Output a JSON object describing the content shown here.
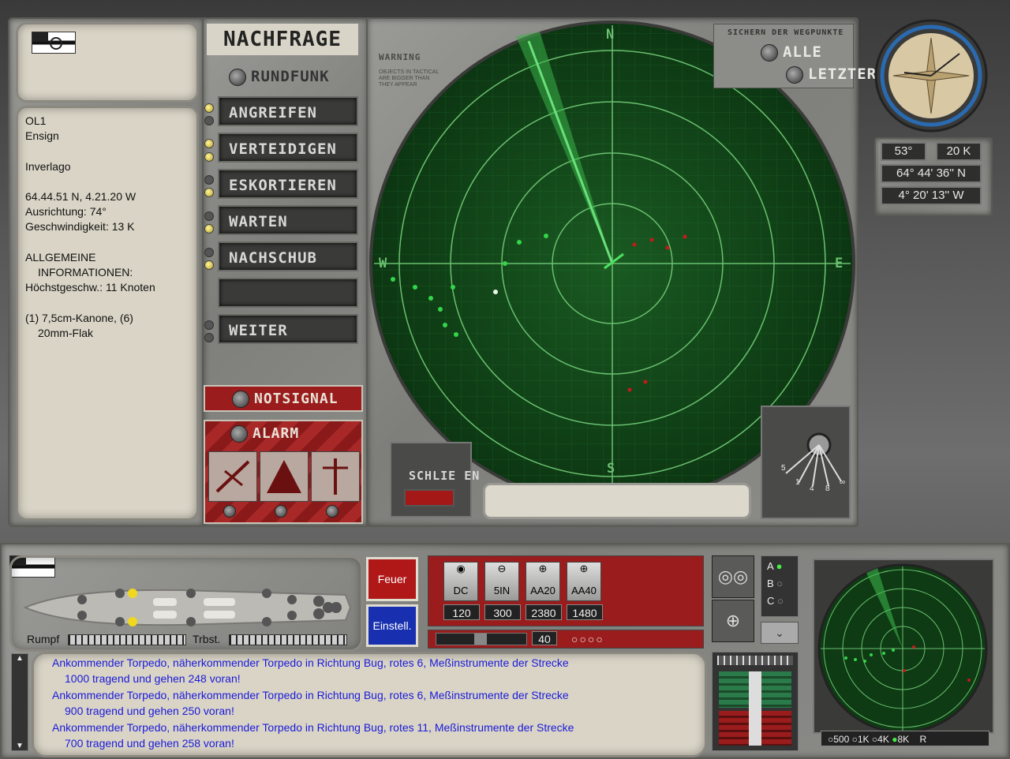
{
  "colors": {
    "radar_green": "#1f7a2a",
    "contact_green": "#33d64a",
    "contact_red": "#c41a1a",
    "alarm_red": "#9a1c1c",
    "message_blue": "#1a1ad8"
  },
  "info": {
    "id": "OL1",
    "rank": "Ensign",
    "name": "Inverlago",
    "position": "64.44.51 N, 4.21.20 W",
    "heading": "Ausrichtung: 74°",
    "speed": "Geschwindigkeit: 13 K",
    "general_1": "ALLGEMEINE",
    "general_2": "INFORMATIONEN:",
    "max_speed": "Höchstgeschw.: 11 Knoten",
    "arm_1": "(1) 7,5cm-Kanone, (6)",
    "arm_2": "20mm-Flak"
  },
  "menu": {
    "title": "NACHFRAGE",
    "radio": "RUNDFUNK",
    "items": [
      "ANGREIFEN",
      "VERTEIDIGEN",
      "ESKORTIEREN",
      "WARTEN",
      "NACHSCHUB",
      "",
      "WEITER"
    ],
    "distress": "NOTSIGNAL",
    "alarm": "ALARM"
  },
  "radar": {
    "warning": "WARNING",
    "warning_sub": [
      "OBJECTS IN TACTICAL",
      "ARE BIGGER THAN",
      "THEY APPEAR"
    ],
    "north": "N",
    "south": "S",
    "east": "E",
    "west": "W",
    "waypoints_title": "SICHERN DER WEGPUNKTE",
    "all": "ALLE",
    "last": "LETZTER",
    "close": "SCHLIE EN",
    "scale_labels": [
      "5",
      "1",
      "4",
      "8",
      "∞"
    ]
  },
  "compass": {
    "bearing": "53°",
    "range": "20 K",
    "lat": "64° 44' 36'' N",
    "lon": "4° 20' 13'' W"
  },
  "bottom": {
    "hull_label": "Rumpf",
    "drive_label": "Trbst.",
    "fire": "Feuer",
    "settings": "Einstell.",
    "weapons": [
      {
        "name": "DC",
        "ammo": "120"
      },
      {
        "name": "5IN",
        "ammo": "300"
      },
      {
        "name": "AA20",
        "ammo": "2380"
      },
      {
        "name": "AA40",
        "ammo": "1480"
      }
    ],
    "elevation": "40",
    "abc": [
      "A",
      "B",
      "C"
    ],
    "radar_ranges": [
      "500",
      "1K",
      "4K",
      "8K"
    ],
    "radar_r": "R"
  },
  "messages": [
    {
      "a": "Ankommender Torpedo, näherkommender Torpedo in Richtung Bug, rotes 6, Meßinstrumente der Strecke",
      "b": "1000 tragend und gehen 248 voran!"
    },
    {
      "a": "Ankommender Torpedo, näherkommender Torpedo in Richtung Bug, rotes 6, Meßinstrumente der Strecke",
      "b": "900 tragend und gehen 250 voran!"
    },
    {
      "a": "Ankommender Torpedo, näherkommender Torpedo in Richtung Bug, rotes 11, Meßinstrumente der Strecke",
      "b": "700 tragend und gehen 258 voran!"
    }
  ]
}
